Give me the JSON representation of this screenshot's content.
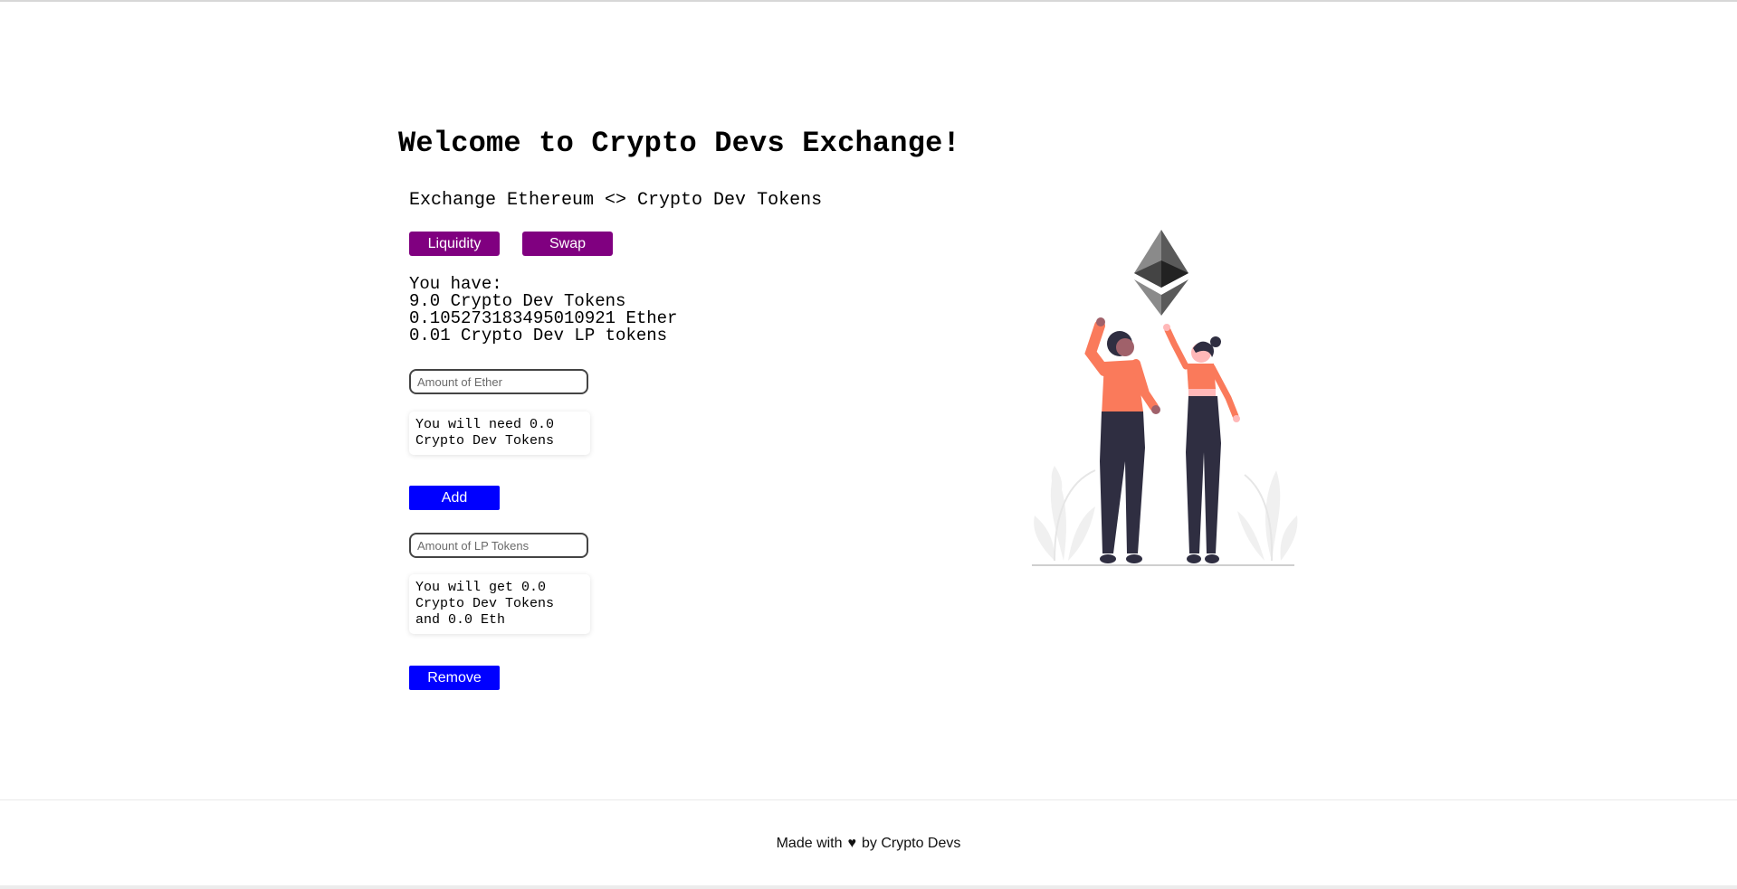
{
  "header": {
    "title": "Welcome to Crypto Devs Exchange!",
    "description": "Exchange Ethereum <> Crypto Dev Tokens"
  },
  "tabs": {
    "liquidity_label": "Liquidity",
    "swap_label": "Swap"
  },
  "balances": {
    "heading": "You have:",
    "crypto_dev_tokens": "9.0 Crypto Dev Tokens",
    "ether": "0.105273183495010921 Ether",
    "lp_tokens": "0.01 Crypto Dev LP tokens"
  },
  "add_liquidity": {
    "ether_placeholder": "Amount of Ether",
    "need_text": "You will need 0.0 Crypto Dev Tokens",
    "add_label": "Add"
  },
  "remove_liquidity": {
    "lp_placeholder": "Amount of LP Tokens",
    "get_text": "You will get 0.0 Crypto Dev Tokens and 0.0 Eth",
    "remove_label": "Remove"
  },
  "footer": {
    "made_with": "Made with",
    "by": "by Crypto Devs",
    "heart_icon": "heart-icon"
  },
  "colors": {
    "tab_button": "#800080",
    "action_button": "#0000ff",
    "person_shirt": "#fa7a5b",
    "person_pants": "#2f2e41"
  }
}
